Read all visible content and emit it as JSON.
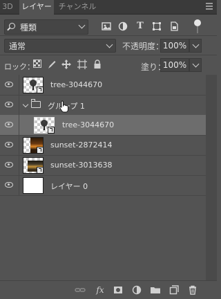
{
  "tabs": [
    {
      "label": "3D",
      "active": false
    },
    {
      "label": "レイヤー",
      "active": true
    },
    {
      "label": "チャンネル",
      "active": false
    }
  ],
  "filter": {
    "label": "種類",
    "icons": [
      "pixel-filter-icon",
      "adjustment-filter-icon",
      "type-filter-icon",
      "shape-filter-icon",
      "smart-object-filter-icon"
    ]
  },
  "blend": {
    "mode": "通常",
    "opacity_label": "不透明度：",
    "opacity_value": "100%"
  },
  "lock": {
    "label": "ロック：",
    "icons": [
      "lock-transparent-icon",
      "lock-image-icon",
      "lock-position-icon",
      "lock-artboard-icon",
      "lock-all-icon"
    ],
    "fill_label": "塗り：",
    "fill_value": "100%"
  },
  "layers": [
    {
      "name": "tree-3044670",
      "thumb": "tree",
      "visible": true,
      "selected": false,
      "indent": 0
    },
    {
      "name": "グループ 1",
      "thumb": "folder",
      "visible": true,
      "selected": false,
      "indent": 0,
      "expanded": true
    },
    {
      "name": "tree-3044670",
      "thumb": "tree",
      "visible": true,
      "selected": true,
      "indent": 1
    },
    {
      "name": "sunset-2872414",
      "thumb": "sunset",
      "visible": true,
      "selected": false,
      "indent": 0
    },
    {
      "name": "sunset-3013638",
      "thumb": "sunset",
      "visible": true,
      "selected": false,
      "indent": 0
    },
    {
      "name": "レイヤー 0",
      "thumb": "white",
      "visible": true,
      "selected": false,
      "indent": 0
    }
  ],
  "footer": {
    "fx_label": "fx",
    "buttons": [
      "link-layers-icon",
      "fx-icon",
      "mask-icon",
      "adjustment-layer-icon",
      "new-group-icon",
      "new-layer-icon",
      "delete-icon"
    ]
  },
  "colors": {
    "panel": "#535353",
    "selected": "#6d6d6d",
    "tabbar": "#3a3a3a"
  }
}
